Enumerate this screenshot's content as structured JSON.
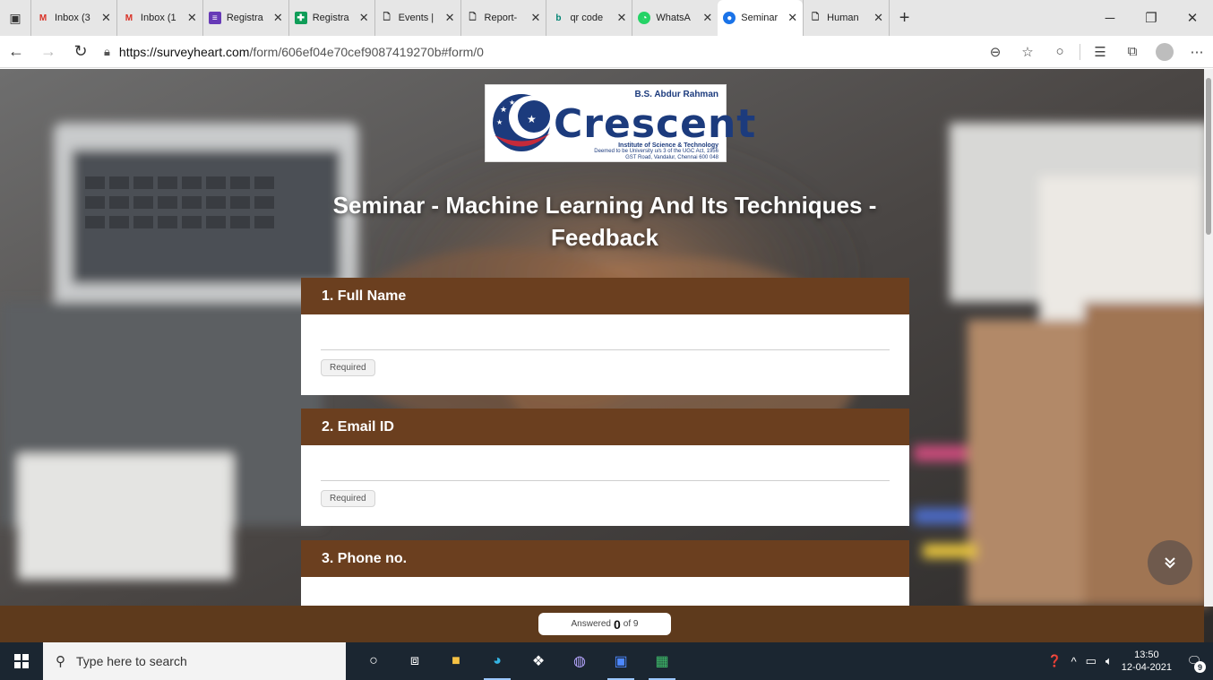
{
  "browser": {
    "tabs": [
      {
        "title": "Inbox (3",
        "favicon": "gmail-icon",
        "color": "#d93025"
      },
      {
        "title": "Inbox (1",
        "favicon": "gmail-icon",
        "color": "#d93025"
      },
      {
        "title": "Registra",
        "favicon": "forms-icon",
        "color": "#673ab7"
      },
      {
        "title": "Registra",
        "favicon": "sheets-icon",
        "color": "#0f9d58"
      },
      {
        "title": "Events |",
        "favicon": "page-icon",
        "color": "#555555"
      },
      {
        "title": "Report-",
        "favicon": "page-icon",
        "color": "#555555"
      },
      {
        "title": "qr code",
        "favicon": "bing-icon",
        "color": "#008373"
      },
      {
        "title": "WhatsA",
        "favicon": "whatsapp-icon",
        "color": "#25d366"
      },
      {
        "title": "Seminar",
        "favicon": "surveyheart-icon",
        "color": "#1a73e8",
        "active": true
      },
      {
        "title": "Human",
        "favicon": "page-icon",
        "color": "#555555"
      }
    ],
    "url_host": "https://surveyheart.com",
    "url_path": "/form/606ef04e70cef9087419270b#form/0"
  },
  "form": {
    "logo": {
      "top_line": "B.S. Abdur Rahman",
      "brand": "Crescent",
      "sub_line1": "Institute of Science & Technology",
      "sub_line2": "Deemed to be University u/s 3 of the UGC Act, 1956",
      "sub_line3": "GST Road, Vandalur, Chennai 600 048"
    },
    "title": "Seminar - Machine Learning And Its Techniques - Feedback",
    "questions": [
      {
        "label": "1. Full Name",
        "value": "",
        "required": "Required"
      },
      {
        "label": "2. Email ID",
        "value": "",
        "required": "Required"
      },
      {
        "label": "3. Phone no.",
        "value": ""
      }
    ],
    "answered": {
      "prefix": "Answered",
      "count": "0",
      "suffix": "of 9"
    }
  },
  "taskbar": {
    "search_placeholder": "Type here to search",
    "time": "13:50",
    "date": "12-04-2021",
    "notifications": "9"
  },
  "colors": {
    "accent": "#6b3f1f",
    "bar": "#5e3a1c"
  }
}
